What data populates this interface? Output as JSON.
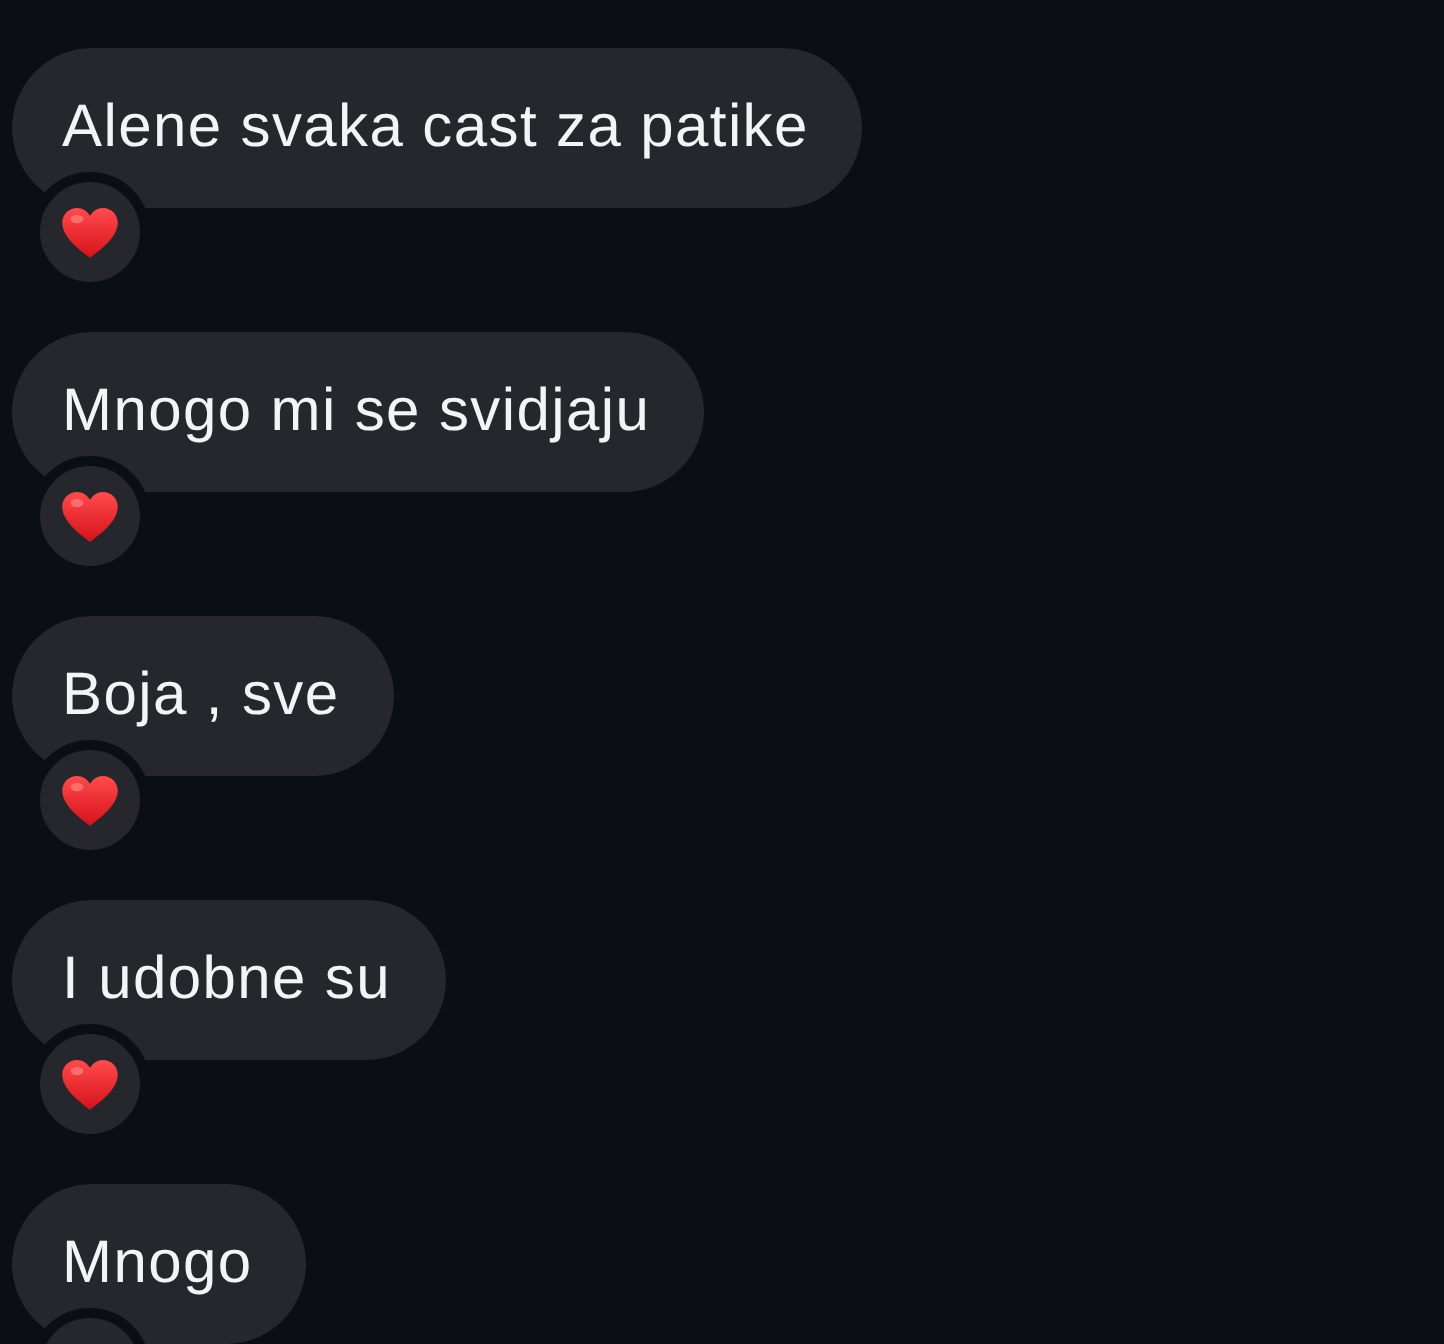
{
  "messages": [
    {
      "text": "Alene svaka cast za patike",
      "reacted": true
    },
    {
      "text": "Mnogo mi se svidjaju",
      "reacted": true
    },
    {
      "text": "Boja , sve",
      "reacted": true
    },
    {
      "text": "I udobne su",
      "reacted": true
    },
    {
      "text": "Mnogo",
      "reacted": true
    }
  ]
}
